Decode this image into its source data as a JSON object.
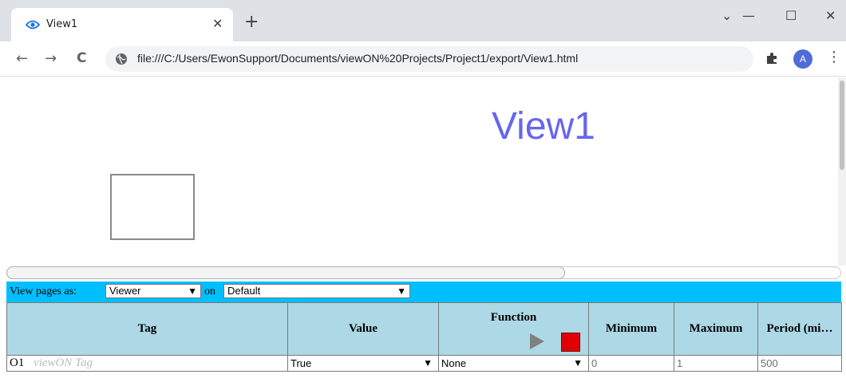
{
  "browser": {
    "tab_title": "View1",
    "tab_close": "✕",
    "new_tab": "+",
    "window_controls": {
      "collapse": "⌄",
      "minimize": "—",
      "maximize": "☐",
      "close": "✕"
    },
    "nav": {
      "back": "←",
      "forward": "→",
      "reload": "C"
    },
    "url": "file:///C:/Users/EwonSupport/Documents/viewON%20Projects/Project1/export/View1.html",
    "avatar_letter": "A",
    "menu": "⋮"
  },
  "page": {
    "title": "View1",
    "title_color": "#6666ee"
  },
  "controls": {
    "view_pages_label": "View pages as:",
    "mode_selected": "Viewer",
    "on_label": "on",
    "target_selected": "Default",
    "bar_color": "#00bfff"
  },
  "table": {
    "headers": {
      "tag": "Tag",
      "value": "Value",
      "function": "Function",
      "minimum": "Minimum",
      "maximum": "Maximum",
      "period": "Period (mi…"
    },
    "rows": [
      {
        "tag": "O1",
        "type": "viewON Tag",
        "value": "True",
        "function": "None",
        "minimum": "0",
        "maximum": "1",
        "period": "500"
      }
    ]
  }
}
